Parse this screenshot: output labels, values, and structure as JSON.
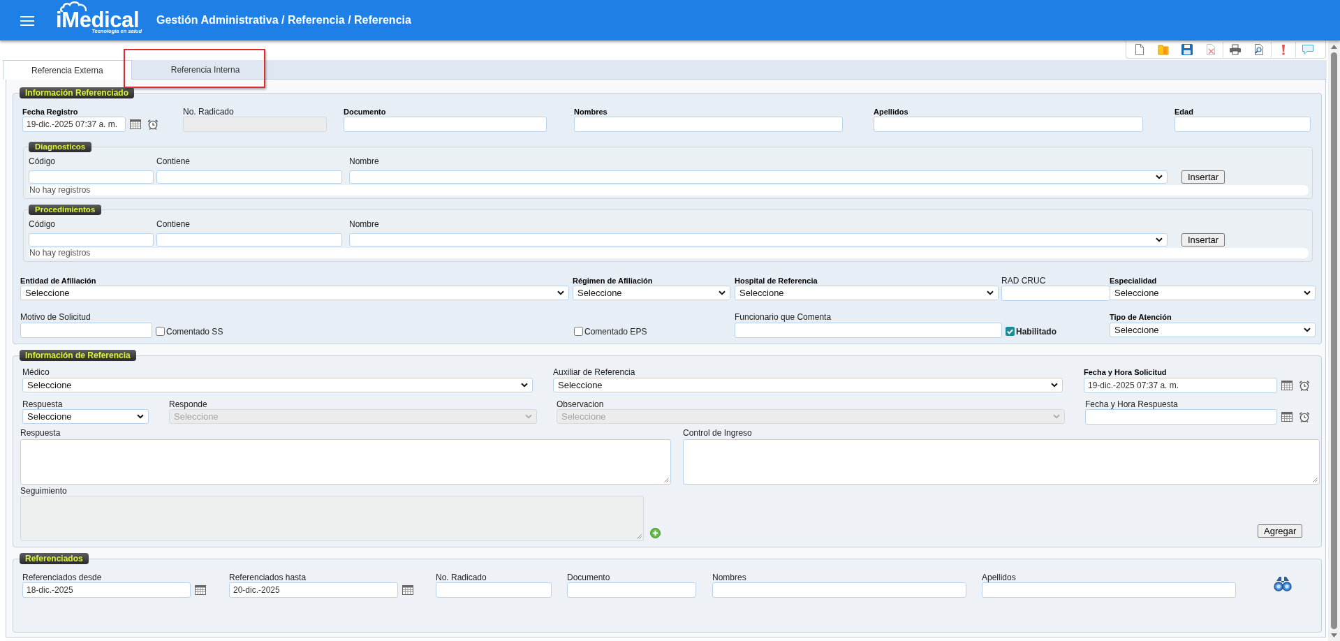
{
  "header": {
    "logo": "iMedical",
    "tagline": "Tecnología en salud",
    "breadcrumb": "Gestión Administrativa / Referencia / Referencia"
  },
  "tabs": [
    {
      "label": "Referencia Externa",
      "selected": true
    },
    {
      "label": "Referencia Interna",
      "selected": false
    }
  ],
  "sections": [
    {
      "legend": "Información Referenciado",
      "blocks": [
        {
          "kind": "fields",
          "fields": [
            {
              "kind": "datetime",
              "label": "Fecha Registro",
              "required": true,
              "value": "19-dic.-2025 07:37 a. m.",
              "disabled": false
            },
            {
              "kind": "text",
              "label": "No. Radicado",
              "required": false,
              "disabled": true
            },
            {
              "kind": "text",
              "label": "Documento",
              "required": true,
              "disabled": false
            },
            {
              "kind": "text",
              "label": "Nombres",
              "required": true,
              "disabled": false
            },
            {
              "kind": "text",
              "label": "Apellidos",
              "required": true,
              "disabled": false
            },
            {
              "kind": "text",
              "label": "Edad",
              "required": true,
              "disabled": false
            }
          ]
        },
        {
          "kind": "grid",
          "legend": "Diagnosticos",
          "columns": [
            {
              "label": "Código",
              "kind": "text"
            },
            {
              "label": "Contiene",
              "kind": "text"
            },
            {
              "label": "Nombre",
              "kind": "select"
            }
          ],
          "button": "Insertar",
          "empty": "No hay registros"
        },
        {
          "kind": "grid",
          "legend": "Procedimientos",
          "columns": [
            {
              "label": "Código",
              "kind": "text"
            },
            {
              "label": "Contiene",
              "kind": "text"
            },
            {
              "label": "Nombre",
              "kind": "select"
            }
          ],
          "button": "Insertar",
          "empty": "No hay registros"
        },
        {
          "kind": "fields",
          "fields": [
            {
              "kind": "select",
              "label": "Entidad de Afiliación",
              "required": true,
              "value": "Seleccione",
              "disabled": false
            },
            {
              "kind": "select",
              "label": "Régimen de Afiliación",
              "required": true,
              "value": "Seleccione",
              "disabled": false
            },
            {
              "kind": "select",
              "label": "Hospital de Referencia",
              "required": true,
              "value": "Seleccione",
              "disabled": false
            },
            {
              "kind": "text",
              "label": "RAD CRUC",
              "required": false,
              "disabled": false
            },
            {
              "kind": "select",
              "label": "Especialidad",
              "required": true,
              "value": "Seleccione",
              "disabled": false
            }
          ]
        },
        {
          "kind": "fields",
          "fields": [
            {
              "kind": "text",
              "label": "Motivo de Solicitud",
              "required": false,
              "disabled": false
            },
            {
              "kind": "checkbox",
              "label": "Comentado SS",
              "required": false,
              "checked": false
            },
            {
              "kind": "checkbox",
              "label": "Comentado EPS",
              "required": false,
              "checked": false
            },
            {
              "kind": "text",
              "label": "Funcionario que Comenta",
              "required": false,
              "disabled": false
            },
            {
              "kind": "checkbox",
              "label": "Habilitado",
              "required": true,
              "checked": true
            },
            {
              "kind": "select",
              "label": "Tipo de Atención",
              "required": true,
              "value": "Seleccione",
              "disabled": false
            }
          ]
        }
      ]
    },
    {
      "legend": "Información de Referencia",
      "blocks": [
        {
          "kind": "fields",
          "fields": [
            {
              "kind": "select",
              "label": "Médico",
              "required": false,
              "value": "Seleccione",
              "disabled": false
            },
            {
              "kind": "select",
              "label": "Auxiliar de Referencia",
              "required": false,
              "value": "Seleccione",
              "disabled": false
            },
            {
              "kind": "datetime",
              "label": "Fecha y Hora Solicitud",
              "required": true,
              "value": "19-dic.-2025 07:37 a. m.",
              "disabled": false
            }
          ]
        },
        {
          "kind": "fields",
          "fields": [
            {
              "kind": "select",
              "label": "Respuesta",
              "required": false,
              "value": "Seleccione",
              "disabled": false
            },
            {
              "kind": "select",
              "label": "Responde",
              "required": false,
              "value": "Seleccione",
              "disabled": true
            },
            {
              "kind": "select",
              "label": "Observacion",
              "required": false,
              "value": "Seleccione",
              "disabled": true
            },
            {
              "kind": "datetime",
              "label": "Fecha y Hora Respuesta",
              "required": false,
              "disabled": false
            }
          ]
        },
        {
          "kind": "fields",
          "fields": [
            {
              "kind": "textarea",
              "label": "Respuesta",
              "required": false,
              "disabled": false
            },
            {
              "kind": "textarea",
              "label": "Control de Ingreso",
              "required": false,
              "disabled": false
            }
          ]
        },
        {
          "kind": "fields",
          "fields": [
            {
              "kind": "textarea",
              "label": "Seguimiento",
              "required": false,
              "disabled": true
            },
            {
              "kind": "add"
            },
            {
              "kind": "button",
              "label": "Agregar"
            }
          ]
        }
      ]
    },
    {
      "legend": "Referenciados",
      "blocks": [
        {
          "kind": "fields",
          "fields": [
            {
              "kind": "date",
              "label": "Referenciados desde",
              "required": false,
              "value": "18-dic.-2025",
              "disabled": false
            },
            {
              "kind": "date",
              "label": "Referenciados hasta",
              "required": false,
              "value": "20-dic.-2025",
              "disabled": false
            },
            {
              "kind": "text",
              "label": "No. Radicado",
              "required": false,
              "disabled": false
            },
            {
              "kind": "text",
              "label": "Documento",
              "required": false,
              "disabled": false
            },
            {
              "kind": "text",
              "label": "Nombres",
              "required": false,
              "disabled": false
            },
            {
              "kind": "text",
              "label": "Apellidos",
              "required": false,
              "disabled": false
            },
            {
              "kind": "search"
            }
          ]
        }
      ]
    }
  ]
}
